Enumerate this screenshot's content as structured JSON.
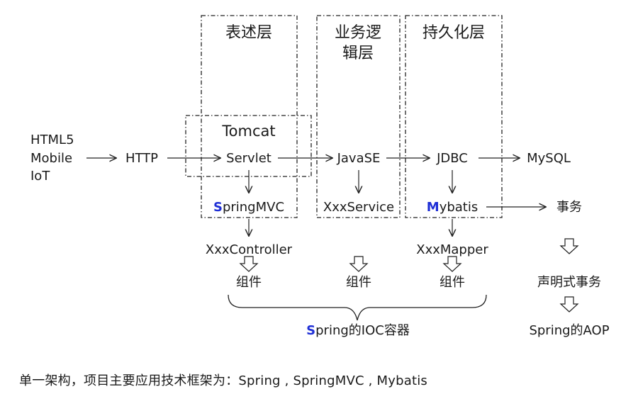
{
  "layers": {
    "presentation": "表述层",
    "business_line1": "业务逻",
    "business_line2": "辑层",
    "persistence": "持久化层"
  },
  "clients": [
    "HTML5",
    "Mobile",
    "IoT"
  ],
  "nodes": {
    "http": "HTTP",
    "tomcat": "Tomcat",
    "servlet": "Servlet",
    "javase": "JavaSE",
    "jdbc": "JDBC",
    "mysql": "MySQL",
    "springmvc_initial": "S",
    "springmvc_rest": "pringMVC",
    "xxxservice": "XxxService",
    "mybatis_initial": "M",
    "mybatis_rest": "ybatis",
    "transaction": "事务",
    "xxxcontroller": "XxxController",
    "xxxmapper": "XxxMapper",
    "component": "组件",
    "declarative_tx": "声明式事务",
    "spring_ioc_initial": "S",
    "spring_ioc_rest": "pring的IOC容器",
    "spring_aop": "Spring的AOP"
  },
  "caption": "单一架构，项目主要应用技术框架为：Spring , SpringMVC , Mybatis",
  "colors": {
    "highlight": "#1f2fd6",
    "text": "#1a1a1a",
    "line": "#222222"
  }
}
